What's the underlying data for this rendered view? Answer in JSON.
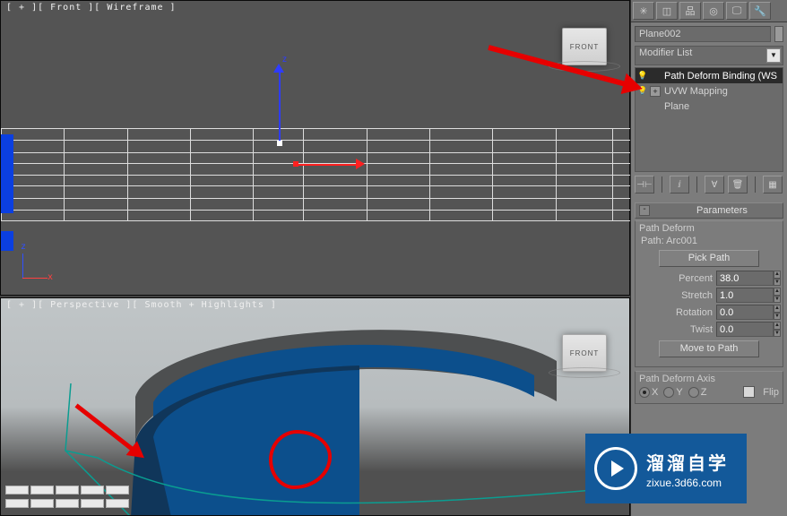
{
  "viewport_front_label": "[ + ][ Front ][ Wireframe ]",
  "viewport_persp_label": "[ + ][ Perspective ][ Smooth + Highlights ]",
  "viewcube_face": "FRONT",
  "axis_z": "z",
  "axis_x": "x",
  "object_name": "Plane002",
  "modifier_list_label": "Modifier List",
  "stack": {
    "item0": "Path Deform Binding (WS",
    "item1": "UVW Mapping",
    "item2": "Plane"
  },
  "rollout": {
    "header": "Parameters",
    "group1_title": "Path Deform",
    "path_label": "Path:",
    "path_value": "Arc001",
    "pick_path_btn": "Pick Path",
    "percent_label": "Percent",
    "percent_value": "38.0",
    "stretch_label": "Stretch",
    "stretch_value": "1.0",
    "rotation_label": "Rotation",
    "rotation_value": "0.0",
    "twist_label": "Twist",
    "twist_value": "0.0",
    "move_to_path_btn": "Move to Path",
    "axis_group_title": "Path Deform Axis",
    "axis_x": "X",
    "axis_y": "Y",
    "axis_z": "Z",
    "flip_label": "Flip"
  },
  "watermark": {
    "cn": "溜溜自学",
    "url": "zixue.3d66.com"
  }
}
